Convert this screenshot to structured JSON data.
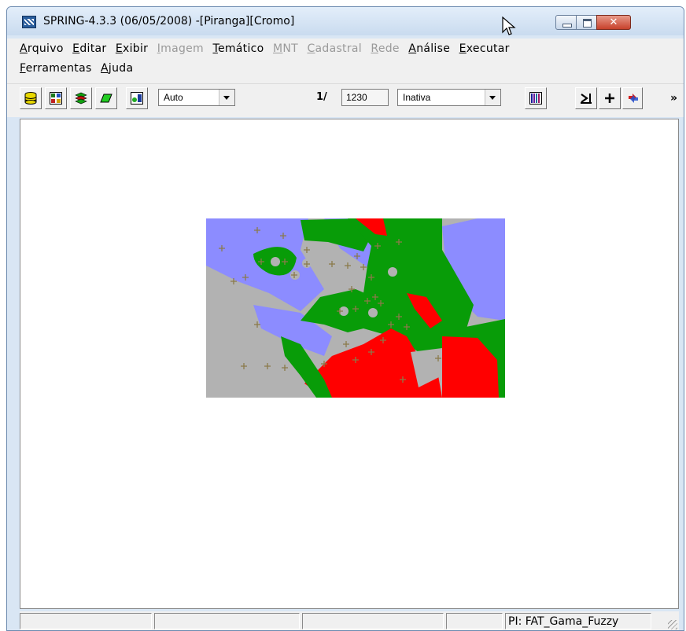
{
  "window": {
    "title": "SPRING-4.3.3 (06/05/2008) -[Piranga][Cromo]",
    "close_glyph": "✕"
  },
  "menu": {
    "row1": [
      {
        "label": "Arquivo",
        "enabled": true
      },
      {
        "label": "Editar",
        "enabled": true
      },
      {
        "label": "Exibir",
        "enabled": true
      },
      {
        "label": "Imagem",
        "enabled": false
      },
      {
        "label": "Temático",
        "enabled": true
      },
      {
        "label": "MNT",
        "enabled": false
      },
      {
        "label": "Cadastral",
        "enabled": false
      },
      {
        "label": "Rede",
        "enabled": false
      },
      {
        "label": "Análise",
        "enabled": true
      },
      {
        "label": "Executar",
        "enabled": true
      }
    ],
    "row2": [
      {
        "label": "Ferramentas",
        "enabled": true
      },
      {
        "label": "Ajuda",
        "enabled": true
      }
    ]
  },
  "toolbar": {
    "icons": [
      "database-icon",
      "model-icon",
      "layers-icon",
      "plane-icon",
      "view-icon"
    ],
    "zoom_mode": "Auto",
    "scale_prefix": "1/",
    "scale_value": "1230",
    "cursor_mode": "Inativa",
    "chevron": "»"
  },
  "map": {
    "colors": {
      "background": "#b2b2b2",
      "class_blue": "#8c8cff",
      "class_green": "#089c08",
      "class_red": "#ff0000",
      "sample_marker": "#8a7a4a"
    }
  },
  "status": {
    "panels": [
      "",
      "",
      "",
      "",
      "PI: FAT_Gama_Fuzzy"
    ]
  }
}
